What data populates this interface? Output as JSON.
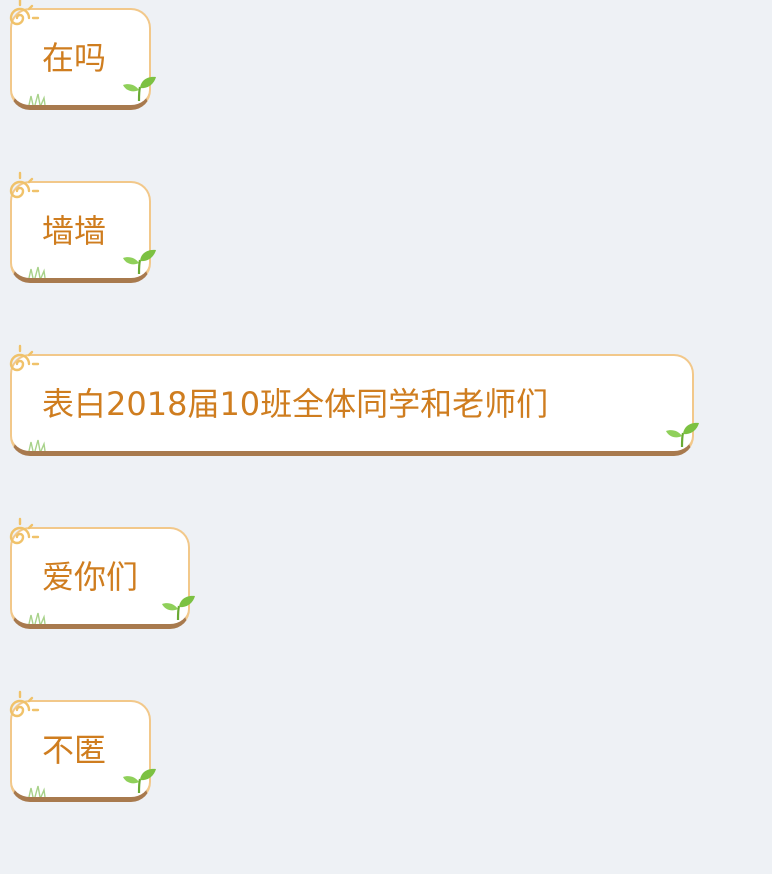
{
  "messages": [
    {
      "text": "在吗"
    },
    {
      "text": "墙墙"
    },
    {
      "text": "表白2018届10班全体同学和老师们"
    },
    {
      "text": "爱你们"
    },
    {
      "text": "不匿"
    }
  ],
  "colors": {
    "background": "#eef1f5",
    "bubble_fill": "#ffffff",
    "bubble_border": "#f2c88a",
    "bubble_ground": "#a87a4e",
    "text": "#cf7d1f",
    "sun": "#f0c26a",
    "sprout": "#7cc142"
  },
  "icons": {
    "sun": "sun-icon",
    "sprout": "sprout-icon",
    "grass": "grass-icon"
  }
}
